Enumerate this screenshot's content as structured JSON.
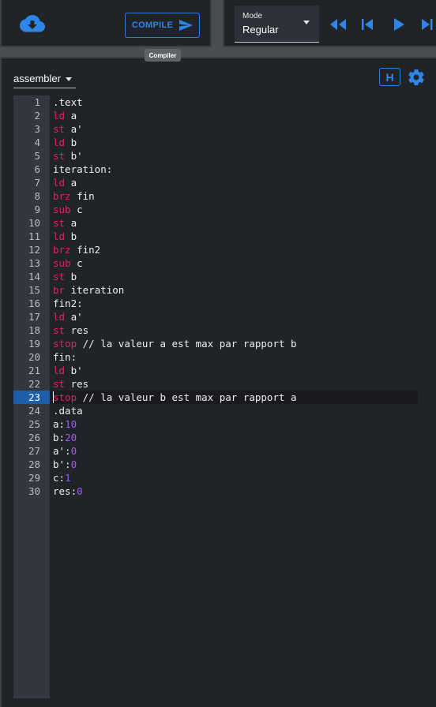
{
  "toolbar": {
    "download_icon": "cloud-download-icon",
    "compile_label": "COMPILE",
    "compile_tooltip": "Compiler",
    "mode_label": "Mode",
    "mode_value": "Regular",
    "controls": [
      "fast-rewind-icon",
      "skip-previous-icon",
      "play-icon",
      "skip-next-icon"
    ]
  },
  "editor": {
    "language": "assembler",
    "help_label": "H",
    "settings_icon": "gear-icon",
    "active_line": 23,
    "lines": [
      {
        "no": "1",
        "tokens": [
          {
            "t": ".text",
            "c": "plain"
          }
        ]
      },
      {
        "no": "2",
        "tokens": [
          {
            "t": "ld",
            "c": "kw"
          },
          {
            "t": " a",
            "c": "plain"
          }
        ]
      },
      {
        "no": "3",
        "tokens": [
          {
            "t": "st",
            "c": "kw"
          },
          {
            "t": " a'",
            "c": "plain"
          }
        ]
      },
      {
        "no": "4",
        "tokens": [
          {
            "t": "ld",
            "c": "kw"
          },
          {
            "t": " b",
            "c": "plain"
          }
        ]
      },
      {
        "no": "5",
        "tokens": [
          {
            "t": "st",
            "c": "kw"
          },
          {
            "t": " b'",
            "c": "plain"
          }
        ]
      },
      {
        "no": "6",
        "tokens": [
          {
            "t": "iteration:",
            "c": "plain"
          }
        ]
      },
      {
        "no": "7",
        "tokens": [
          {
            "t": "ld",
            "c": "kw"
          },
          {
            "t": " a",
            "c": "plain"
          }
        ]
      },
      {
        "no": "8",
        "tokens": [
          {
            "t": "brz",
            "c": "kw"
          },
          {
            "t": " fin",
            "c": "plain"
          }
        ]
      },
      {
        "no": "9",
        "tokens": [
          {
            "t": "sub",
            "c": "kw"
          },
          {
            "t": " c",
            "c": "plain"
          }
        ]
      },
      {
        "no": "10",
        "tokens": [
          {
            "t": "st",
            "c": "kw"
          },
          {
            "t": " a",
            "c": "plain"
          }
        ]
      },
      {
        "no": "11",
        "tokens": [
          {
            "t": "ld",
            "c": "kw"
          },
          {
            "t": " b",
            "c": "plain"
          }
        ]
      },
      {
        "no": "12",
        "tokens": [
          {
            "t": "brz",
            "c": "kw"
          },
          {
            "t": " fin2",
            "c": "plain"
          }
        ]
      },
      {
        "no": "13",
        "tokens": [
          {
            "t": "sub",
            "c": "kw"
          },
          {
            "t": " c",
            "c": "plain"
          }
        ]
      },
      {
        "no": "14",
        "tokens": [
          {
            "t": "st",
            "c": "kw"
          },
          {
            "t": " b",
            "c": "plain"
          }
        ]
      },
      {
        "no": "15",
        "tokens": [
          {
            "t": "br",
            "c": "kw"
          },
          {
            "t": " iteration",
            "c": "plain"
          }
        ]
      },
      {
        "no": "16",
        "tokens": [
          {
            "t": "fin2:",
            "c": "plain"
          }
        ]
      },
      {
        "no": "17",
        "tokens": [
          {
            "t": "ld",
            "c": "kw"
          },
          {
            "t": " a'",
            "c": "plain"
          }
        ]
      },
      {
        "no": "18",
        "tokens": [
          {
            "t": "st",
            "c": "kw"
          },
          {
            "t": " res",
            "c": "plain"
          }
        ]
      },
      {
        "no": "19",
        "tokens": [
          {
            "t": "stop",
            "c": "kw"
          },
          {
            "t": " // la valeur a est max par rapport b",
            "c": "plain"
          }
        ]
      },
      {
        "no": "20",
        "tokens": [
          {
            "t": "fin:",
            "c": "plain"
          }
        ]
      },
      {
        "no": "21",
        "tokens": [
          {
            "t": "ld",
            "c": "kw"
          },
          {
            "t": " b'",
            "c": "plain"
          }
        ]
      },
      {
        "no": "22",
        "tokens": [
          {
            "t": "st",
            "c": "kw"
          },
          {
            "t": " res",
            "c": "plain"
          }
        ]
      },
      {
        "no": "23",
        "tokens": [
          {
            "t": "stop",
            "c": "kw"
          },
          {
            "t": " // la valeur b est max par rapport a",
            "c": "plain"
          }
        ]
      },
      {
        "no": "24",
        "tokens": [
          {
            "t": ".data",
            "c": "plain"
          }
        ]
      },
      {
        "no": "25",
        "tokens": [
          {
            "t": "a:",
            "c": "plain"
          },
          {
            "t": "10",
            "c": "num"
          }
        ]
      },
      {
        "no": "26",
        "tokens": [
          {
            "t": "b:",
            "c": "plain"
          },
          {
            "t": "20",
            "c": "num"
          }
        ]
      },
      {
        "no": "27",
        "tokens": [
          {
            "t": "a':",
            "c": "plain"
          },
          {
            "t": "0",
            "c": "num"
          }
        ]
      },
      {
        "no": "28",
        "tokens": [
          {
            "t": "b':",
            "c": "plain"
          },
          {
            "t": "0",
            "c": "num"
          }
        ]
      },
      {
        "no": "29",
        "tokens": [
          {
            "t": "c:",
            "c": "plain"
          },
          {
            "t": "1",
            "c": "num"
          }
        ]
      },
      {
        "no": "30",
        "tokens": [
          {
            "t": "res:",
            "c": "plain"
          },
          {
            "t": "0",
            "c": "num"
          }
        ]
      }
    ]
  },
  "colors": {
    "accent": "#2e86e8",
    "keyword": "#e0245e",
    "number": "#a855f7",
    "active_line": "#1c5fa8"
  }
}
